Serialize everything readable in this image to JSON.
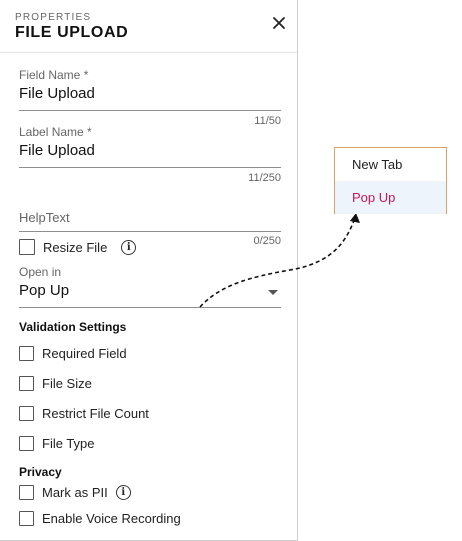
{
  "header": {
    "overline": "PROPERTIES",
    "title": "FILE UPLOAD"
  },
  "fields": {
    "field_name": {
      "label": "Field Name *",
      "value": "File Upload",
      "counter": "11/50"
    },
    "label_name": {
      "label": "Label Name *",
      "value": "File Upload",
      "counter": "11/250"
    },
    "help_text": {
      "placeholder": "HelpText",
      "counter": "0/250"
    },
    "open_in": {
      "label": "Open in",
      "value": "Pop Up"
    }
  },
  "resize_file": {
    "label": "Resize File",
    "checked": false
  },
  "validation": {
    "title": "Validation Settings",
    "items": [
      {
        "label": "Required Field",
        "checked": false
      },
      {
        "label": "File Size",
        "checked": false
      },
      {
        "label": "Restrict File Count",
        "checked": false
      },
      {
        "label": "File Type",
        "checked": false
      }
    ]
  },
  "privacy": {
    "title": "Privacy",
    "items": [
      {
        "label": "Mark as PII",
        "checked": false
      },
      {
        "label": "Enable Voice Recording",
        "checked": false
      }
    ]
  },
  "dropdown_menu": {
    "options": [
      "New Tab",
      "Pop Up"
    ],
    "selected": "Pop Up"
  },
  "colors": {
    "menu_border": "#e0a060",
    "selected_text": "#c2185b",
    "selected_bg": "#eef4fb"
  }
}
